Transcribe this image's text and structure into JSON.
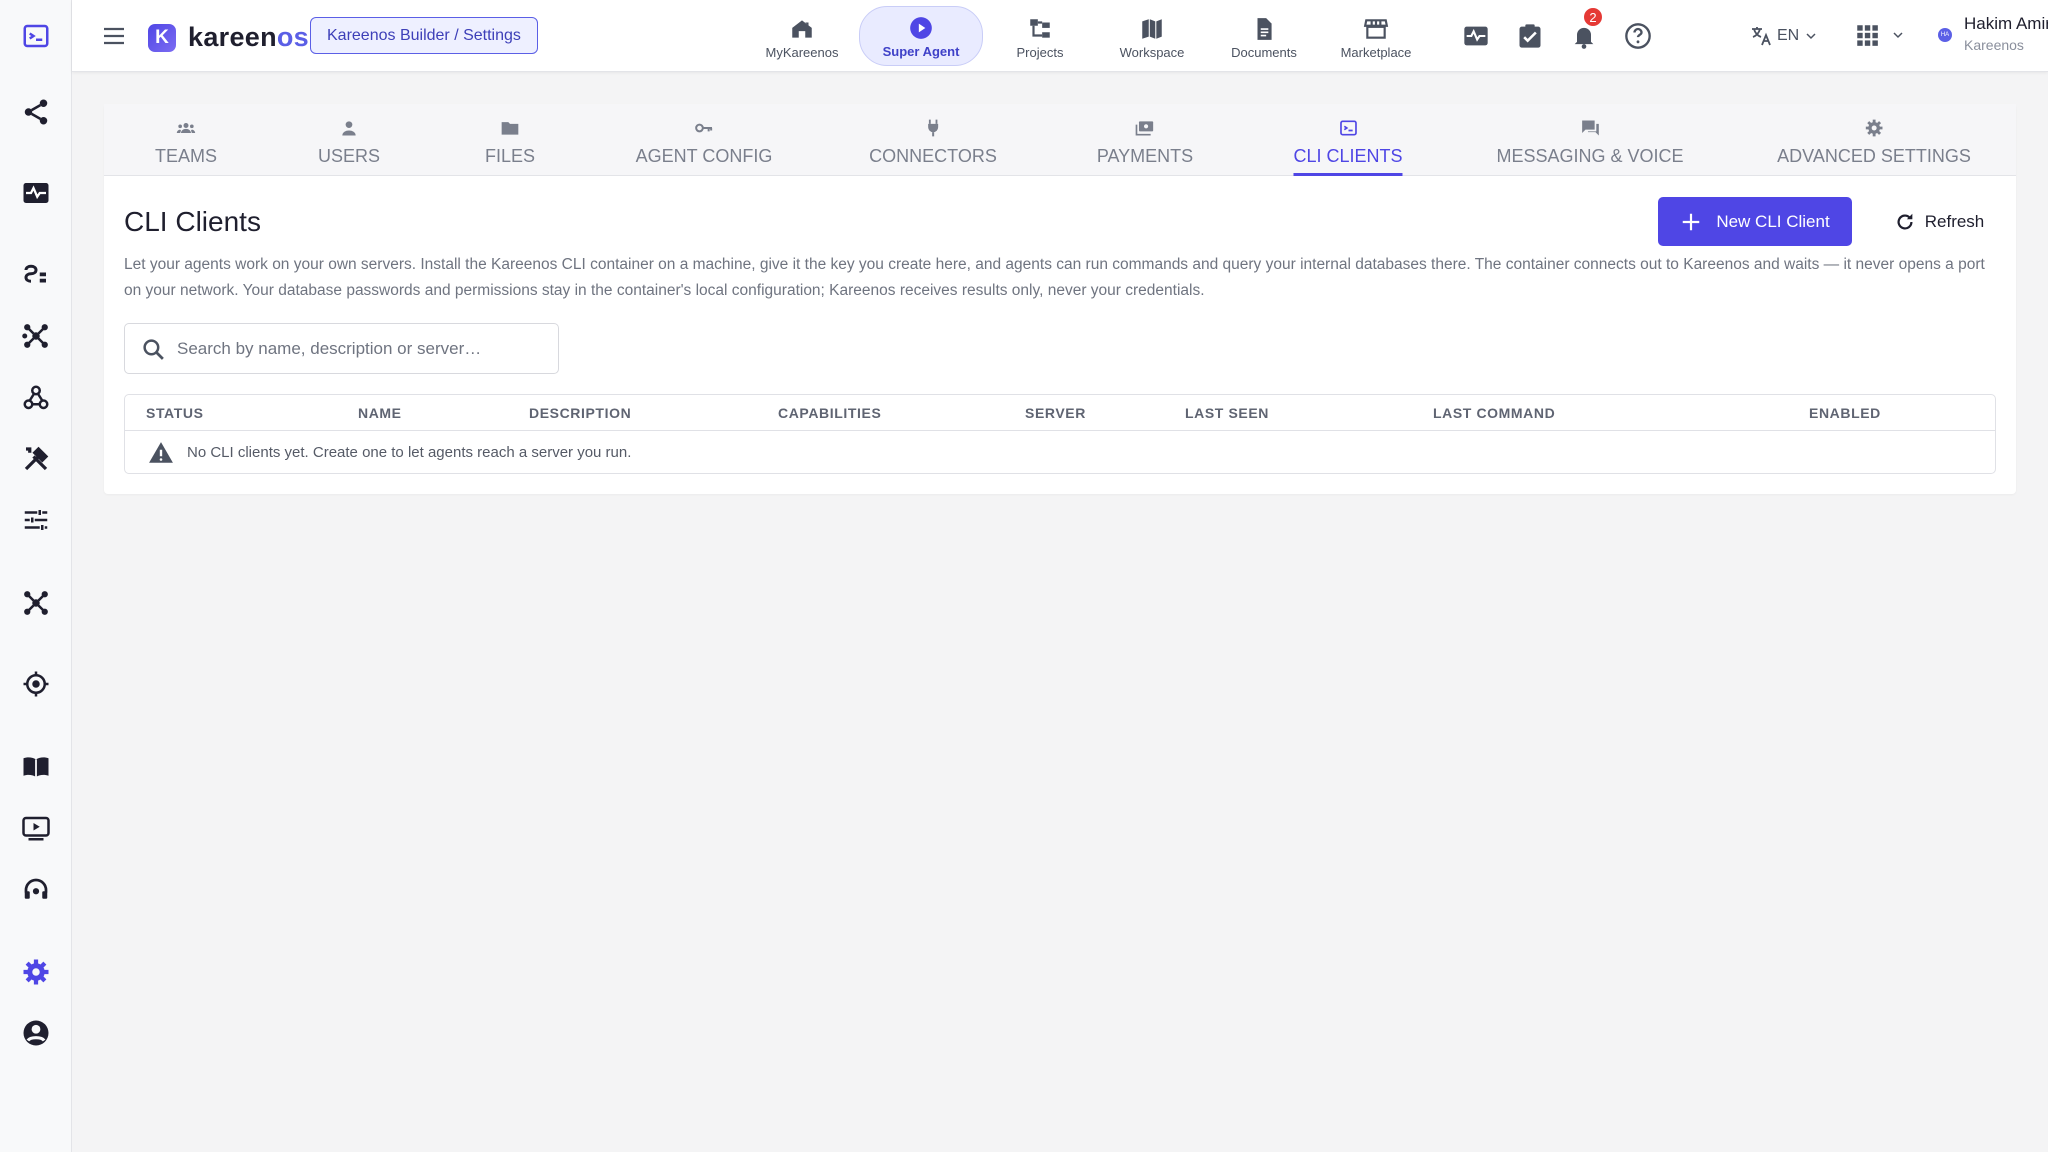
{
  "rail": {
    "items": [
      {
        "name": "rail-terminal-icon"
      },
      {
        "name": "rail-share-icon"
      },
      {
        "name": "rail-monitor-icon"
      },
      {
        "name": "rail-schema-icon"
      },
      {
        "name": "rail-hub-icon"
      },
      {
        "name": "rail-webhook-icon"
      },
      {
        "name": "rail-tools-icon"
      },
      {
        "name": "rail-tune-icon"
      },
      {
        "name": "rail-hub2-icon"
      },
      {
        "name": "rail-target-icon"
      },
      {
        "name": "rail-book-icon"
      },
      {
        "name": "rail-video-icon"
      },
      {
        "name": "rail-support-icon"
      },
      {
        "name": "rail-settings-icon"
      },
      {
        "name": "rail-account-icon"
      }
    ],
    "accent": "#4f46e5"
  },
  "header": {
    "logo_mark": "K",
    "logo_text_main": "kareen",
    "logo_text_accent": "os",
    "breadcrumb": "Kareenos Builder / Settings",
    "nav": [
      {
        "label": "MyKareenos",
        "icon": "home-icon"
      },
      {
        "label": "Super Agent",
        "icon": "play-icon",
        "active": true
      },
      {
        "label": "Projects",
        "icon": "hierarchy-icon"
      },
      {
        "label": "Workspace",
        "icon": "book-icon"
      },
      {
        "label": "Documents",
        "icon": "document-icon"
      },
      {
        "label": "Marketplace",
        "icon": "store-icon"
      }
    ],
    "notification_count": "2",
    "language": "EN",
    "user_name": "Hakim Amir",
    "user_org": "Kareenos",
    "user_initials": "HA"
  },
  "tabs": [
    {
      "label": "TEAMS",
      "icon": "teams-icon"
    },
    {
      "label": "USERS",
      "icon": "user-icon"
    },
    {
      "label": "FILES",
      "icon": "folder-icon"
    },
    {
      "label": "AGENT CONFIG",
      "icon": "key-icon"
    },
    {
      "label": "CONNECTORS",
      "icon": "plug-icon"
    },
    {
      "label": "PAYMENTS",
      "icon": "payments-icon"
    },
    {
      "label": "CLI CLIENTS",
      "icon": "terminal-icon",
      "active": true
    },
    {
      "label": "MESSAGING & VOICE",
      "icon": "chat-icon"
    },
    {
      "label": "ADVANCED SETTINGS",
      "icon": "gear-icon"
    }
  ],
  "main": {
    "title": "CLI Clients",
    "new_button": "New CLI Client",
    "refresh_button": "Refresh",
    "description": "Let your agents work on your own servers. Install the Kareenos CLI container on a machine, give it the key you create here, and agents can run commands and query your internal databases there. The container connects out to Kareenos and waits — it never opens a port on your network. Your database passwords and permissions stay in the container's local configuration; Kareenos receives results only, never your credentials.",
    "search_placeholder": "Search by name, description or server…",
    "search_value": "",
    "columns": [
      "STATUS",
      "NAME",
      "DESCRIPTION",
      "CAPABILITIES",
      "SERVER",
      "LAST SEEN",
      "LAST COMMAND",
      "ENABLED"
    ],
    "empty_message": "No CLI clients yet. Create one to let agents reach a server you run."
  },
  "colors": {
    "primary": "#4f46e5",
    "badge": "#e53935",
    "text_muted": "#6f7480"
  }
}
